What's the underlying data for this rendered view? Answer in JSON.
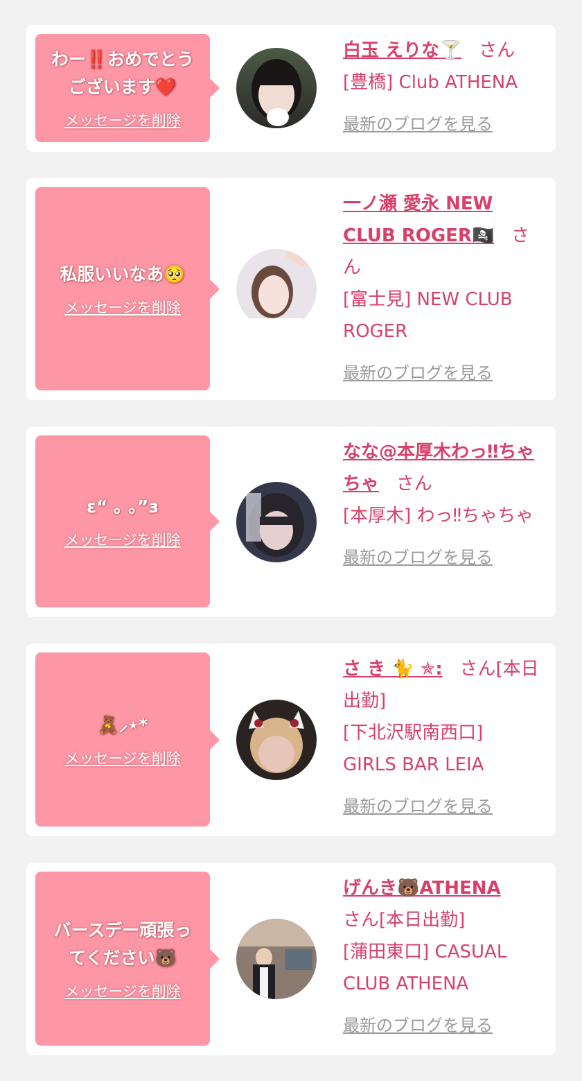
{
  "colors": {
    "background": "#f2f2f2",
    "card": "#ffffff",
    "bubble": "#fd96a5",
    "accent": "#d8406a",
    "blog_link": "#9a9a9a"
  },
  "cards": [
    {
      "message": "わー‼️おめでとう\nございます❤️",
      "delete_label": "メッセージを削除",
      "cast_name": "白玉 えりな🍸",
      "honorific": "さん",
      "shop": "[豊橋] Club ATHENA",
      "blog_label": "最新のブログを見る"
    },
    {
      "message": "私服いいなあ🥺",
      "delete_label": "メッセージを削除",
      "cast_name": "一ノ瀬 愛永 NEW CLUB ROGER🏴‍☠️",
      "honorific": "さん",
      "shop": "[富士見] NEW CLUB ROGER",
      "blog_label": "最新のブログを見る"
    },
    {
      "message": "ε“ ｡ ｡”з",
      "delete_label": "メッセージを削除",
      "cast_name": "なな@本厚木わっ‼ちゃちゃ",
      "honorific": "さん",
      "shop": "[本厚木] わっ‼ちゃちゃ",
      "blog_label": "最新のブログを見る"
    },
    {
      "message": "🧸⸝⋆*",
      "delete_label": "メッセージを削除",
      "cast_name": "さ き 🐈 ✯:",
      "honorific": "さん[本日出勤]",
      "shop": "[下北沢駅南西口] GIRLS BAR LEIA",
      "blog_label": "最新のブログを見る"
    },
    {
      "message": "バースデー頑張っ\nてください🐻",
      "delete_label": "メッセージを削除",
      "cast_name": "げんき🐻ATHENA",
      "honorific": "さん[本日出勤]",
      "shop": "[蒲田東口] CASUAL CLUB ATHENA",
      "blog_label": "最新のブログを見る"
    }
  ]
}
